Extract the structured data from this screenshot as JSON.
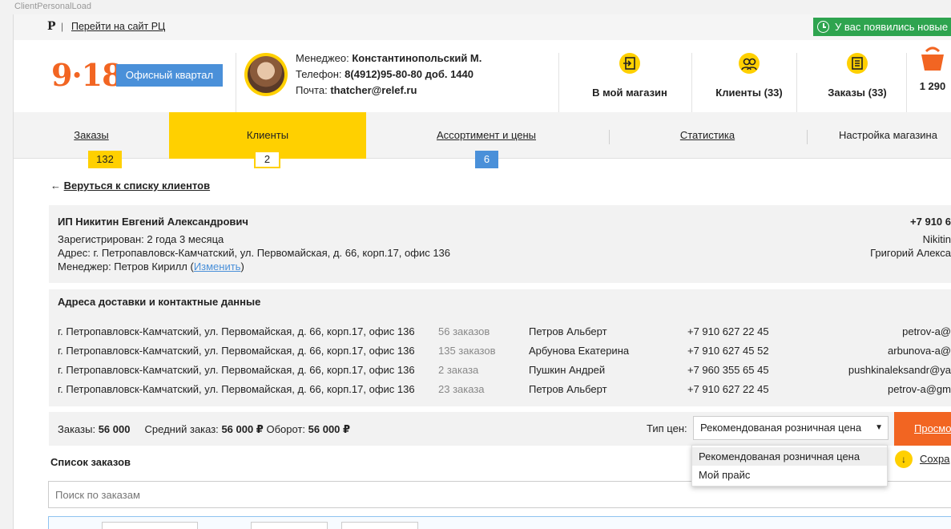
{
  "window_title": "ClientPersonalLoad",
  "topbar": {
    "logo": "Р",
    "separator": "|",
    "site_link": "Перейти на сайт РЦ",
    "notification": "У вас появились новые"
  },
  "header": {
    "brand": "9·18",
    "office_button": "Офисный квартал",
    "manager_label": "Менеджео:",
    "manager_name": "Константинопольский М.",
    "phone_label": "Телефон:",
    "phone_value": "8(4912)95-80-80 доб. 1440",
    "email_label": "Почта:",
    "email_value": "thatcher@relef.ru",
    "icons": [
      {
        "label": "В мой магазин",
        "icon": "enter-shop-icon"
      },
      {
        "label": "Клиенты (33)",
        "icon": "clients-icon"
      },
      {
        "label": "Заказы (33)",
        "icon": "orders-icon"
      },
      {
        "label": "1 290",
        "icon": "cart-icon"
      }
    ]
  },
  "nav": {
    "tabs": [
      {
        "label": "Заказы",
        "badge": "132"
      },
      {
        "label": "Клиенты",
        "badge": "2"
      },
      {
        "label": "Ассортимент и цены",
        "badge": "6"
      },
      {
        "label": "Статистика",
        "badge": ""
      },
      {
        "label": "Настройка магазина",
        "badge": ""
      }
    ]
  },
  "back": {
    "arrow": "←",
    "label": "Веруться к списку клиентов"
  },
  "client": {
    "name": "ИП Никитин Евгений Александрович",
    "registered": "Зарегистрирован: 2 года 3 месяца",
    "address": "Адрес: г. Петропавловск-Камчатский, ул. Первомайская, д. 66, корп.17, офис 136",
    "manager_prefix": "Менеджер: Петров Кирилл (",
    "manager_change": "Изменить",
    "manager_suffix": ")",
    "phone": "+7 910 6",
    "login": "Nikitin",
    "contact": "Григорий Алекса"
  },
  "addresses": {
    "heading": "Адреса доставки и контактные данные",
    "rows": [
      {
        "address": "г. Петропавловск-Камчатский, ул. Первомайская, д. 66, корп.17, офис 136",
        "orders": "56 заказов",
        "person": "Петров Альберт",
        "phone": "+7 910 627 22 45",
        "email": "petrov-a@"
      },
      {
        "address": "г. Петропавловск-Камчатский, ул. Первомайская, д. 66, корп.17, офис 136",
        "orders": "135 заказов",
        "person": "Арбунова Екатерина",
        "phone": "+7 910 627 45 52",
        "email": "arbunova-a@"
      },
      {
        "address": "г. Петропавловск-Камчатский, ул. Первомайская, д. 66, корп.17, офис 136",
        "orders": "2 заказа",
        "person": "Пушкин Андрей",
        "phone": "+7 960 355 65 45",
        "email": "pushkinaleksandr@ya"
      },
      {
        "address": "г. Петропавловск-Камчатский, ул. Первомайская, д. 66, корп.17, офис 136",
        "orders": "23 заказа",
        "person": "Петров Альберт",
        "phone": "+7 910 627 22 45",
        "email": "petrov-a@gm"
      }
    ]
  },
  "stats": {
    "orders_label": "Заказы:",
    "orders_value": "56 000",
    "avg_label": "Средний заказ:",
    "avg_value": "56 000 ₽",
    "turnover_label": "Оборот:",
    "turnover_value": "56 000 ₽",
    "price_type_label": "Тип цен:",
    "price_type_value": "Рекомендованая розничная цена",
    "view_button": "Просмо"
  },
  "orders": {
    "title": "Список заказов",
    "save_label": "Сохра",
    "search_placeholder": "Поиск по заказам"
  },
  "dropdown": {
    "options": [
      "Рекомендованая розничная цена",
      "Мой прайс"
    ]
  },
  "colors": {
    "accent_yellow": "#ffd000",
    "accent_orange": "#f26522",
    "accent_blue": "#4a90d9",
    "notify_green": "#2ea44f"
  }
}
